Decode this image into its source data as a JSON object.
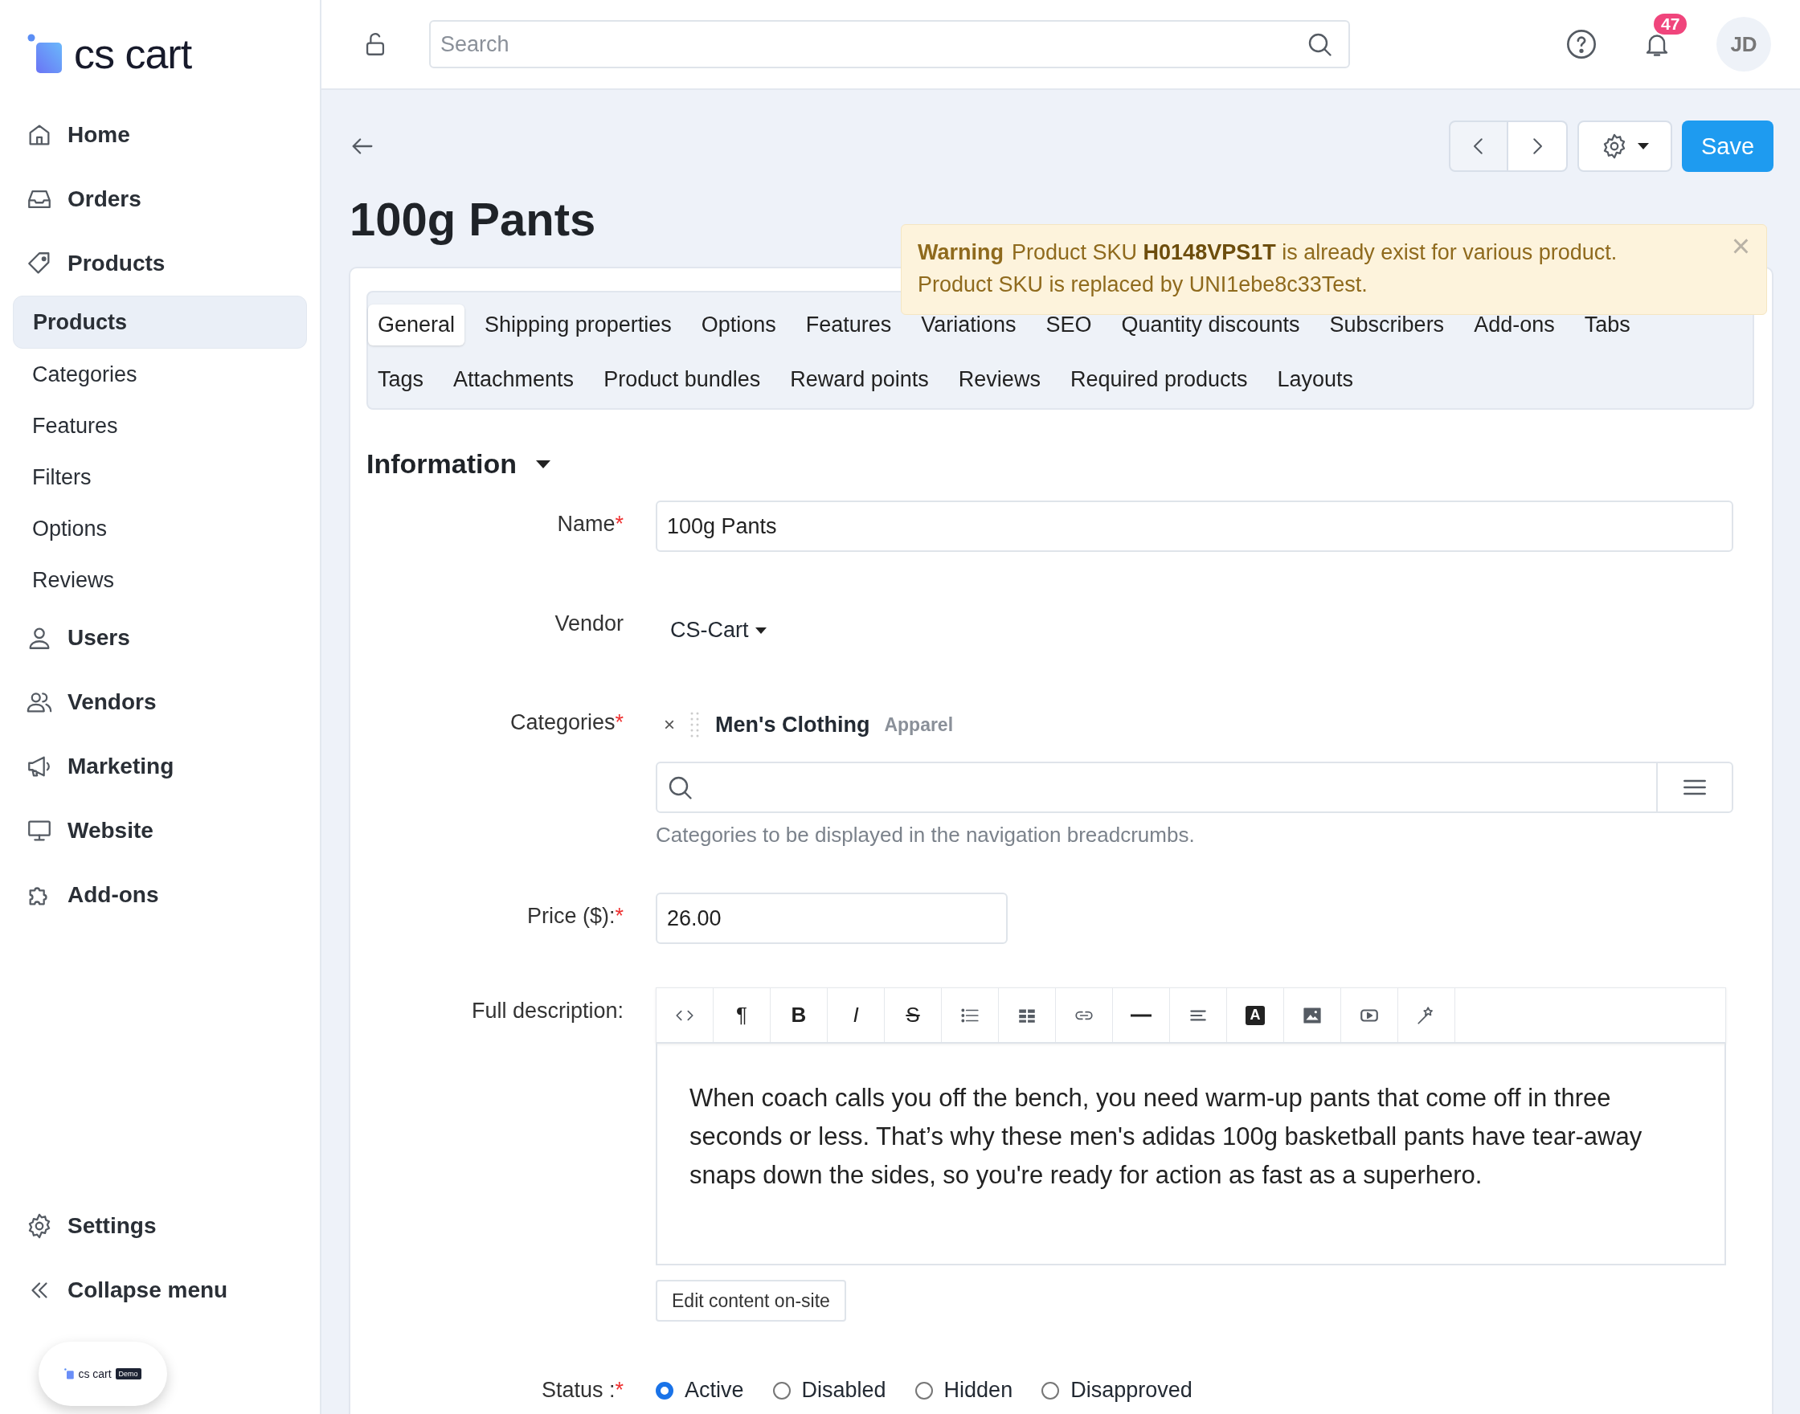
{
  "logo": {
    "text": "cs cart"
  },
  "sidebar": {
    "items": [
      {
        "label": "Home",
        "selected": false
      },
      {
        "label": "Orders",
        "selected": false
      },
      {
        "label": "Products",
        "selected": false,
        "children": [
          {
            "label": "Products",
            "selected": true
          },
          {
            "label": "Categories",
            "selected": false
          },
          {
            "label": "Features",
            "selected": false
          },
          {
            "label": "Filters",
            "selected": false
          },
          {
            "label": "Options",
            "selected": false
          },
          {
            "label": "Reviews",
            "selected": false
          }
        ]
      },
      {
        "label": "Users",
        "selected": false
      },
      {
        "label": "Vendors",
        "selected": false
      },
      {
        "label": "Marketing",
        "selected": false
      },
      {
        "label": "Website",
        "selected": false
      },
      {
        "label": "Add-ons",
        "selected": false
      }
    ],
    "bottom_items": [
      {
        "label": "Settings"
      },
      {
        "label": "Collapse menu"
      }
    ],
    "demo_badge": {
      "logo_text": "cs cart",
      "tag": "Demo"
    }
  },
  "header": {
    "search": {
      "placeholder": "Search"
    },
    "notifications": "47",
    "avatar": "JD"
  },
  "page": {
    "title": "100g Pants",
    "save": "Save"
  },
  "warning": {
    "title": "Warning",
    "lines": [
      "Product SKU **H0148VPS1T** is already exist for various product.",
      "Product SKU is replaced by UNI1ebe8c33Test."
    ],
    "close": "×"
  },
  "tab_rows": [
    [
      {
        "label": "General",
        "selected": true
      },
      {
        "label": "Shipping properties",
        "selected": false
      },
      {
        "label": "Options",
        "selected": false
      },
      {
        "label": "Features",
        "selected": false
      },
      {
        "label": "Variations",
        "selected": false
      },
      {
        "label": "SEO",
        "selected": false
      },
      {
        "label": "Quantity discounts",
        "selected": false
      },
      {
        "label": "Subscribers",
        "selected": false
      },
      {
        "label": "Add-ons",
        "selected": false
      },
      {
        "label": "Tabs",
        "selected": false
      }
    ],
    [
      {
        "label": "Tags",
        "selected": false
      },
      {
        "label": "Attachments",
        "selected": false
      },
      {
        "label": "Product bundles",
        "selected": false
      },
      {
        "label": "Reward points",
        "selected": false
      },
      {
        "label": "Reviews",
        "selected": false
      },
      {
        "label": "Required products",
        "selected": false
      },
      {
        "label": "Layouts",
        "selected": false
      }
    ]
  ],
  "section": {
    "title": "Information",
    "expanded": true
  },
  "form": {
    "name": {
      "label": "Name",
      "mark": "*",
      "value": "100g Pants"
    },
    "vendor": {
      "label": "Vendor",
      "value": "CS-Cart"
    },
    "categories": {
      "label": "Categories",
      "mark": "*",
      "remove": "×",
      "items": [
        {
          "name": "Men's Clothing",
          "parent": "Apparel"
        }
      ],
      "help": "Categories to be displayed in the navigation breadcrumbs."
    },
    "price": {
      "label": "Price ($):",
      "mark": "*",
      "value": "26.00"
    },
    "description": {
      "label": "Full description:",
      "toolbar": [
        {
          "kind": "code"
        },
        {
          "kind": "glyph",
          "label": "¶"
        },
        {
          "kind": "bold",
          "label": "B"
        },
        {
          "kind": "italic",
          "label": "I"
        },
        {
          "kind": "strike",
          "label": "S"
        },
        {
          "kind": "list"
        },
        {
          "kind": "table"
        },
        {
          "kind": "link"
        },
        {
          "kind": "rule"
        },
        {
          "kind": "align"
        },
        {
          "kind": "letter",
          "label": "A"
        },
        {
          "kind": "image"
        },
        {
          "kind": "video"
        },
        {
          "kind": "magic"
        }
      ],
      "text": "When coach calls you off the bench, you need warm-up pants that come off in three seconds or less. That’s why these men's adidas 100g basketball pants have tear-away snaps down the sides, so you're ready for action as fast as a superhero.",
      "edit_button": "Edit content on-site"
    },
    "status": {
      "label": "Status :",
      "mark": "*",
      "options": [
        {
          "label": "Active",
          "selected": true
        },
        {
          "label": "Disabled",
          "selected": false
        },
        {
          "label": "Hidden",
          "selected": false
        },
        {
          "label": "Disapproved",
          "selected": false
        }
      ]
    }
  }
}
